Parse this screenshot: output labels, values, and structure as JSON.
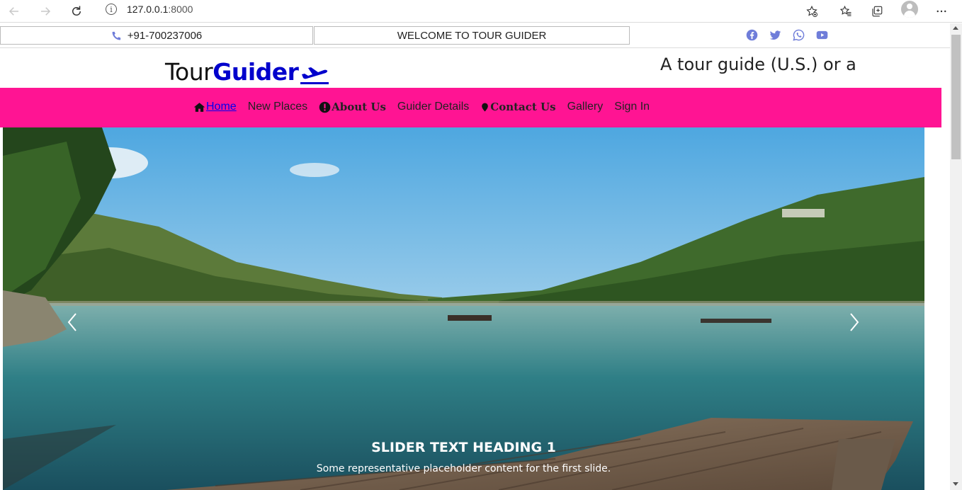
{
  "browser": {
    "url_host": "127.0.0.1",
    "url_port": ":8000",
    "info_symbol": "i"
  },
  "topbar": {
    "phone": "+91-700237006",
    "welcome": "WELCOME TO TOUR GUIDER",
    "social_icons": [
      "facebook-icon",
      "twitter-icon",
      "whatsapp-icon",
      "youtube-icon"
    ],
    "social_color": "#6f7dd9"
  },
  "brand": {
    "logo_light": "Tour",
    "logo_bold": "Guider",
    "marquee": "A tour guide (U.S.) or a tou"
  },
  "navbar": {
    "color": "#ff1493",
    "items": {
      "home": "Home",
      "new_places": "New Places",
      "about": "About Us",
      "guider_details": "Guider Details",
      "contact": "Contact Us",
      "gallery": "Gallery",
      "sign_in": "Sign In"
    }
  },
  "carousel": {
    "heading": "SLIDER TEXT HEADING 1",
    "text": "Some representative placeholder content for the first slide."
  }
}
